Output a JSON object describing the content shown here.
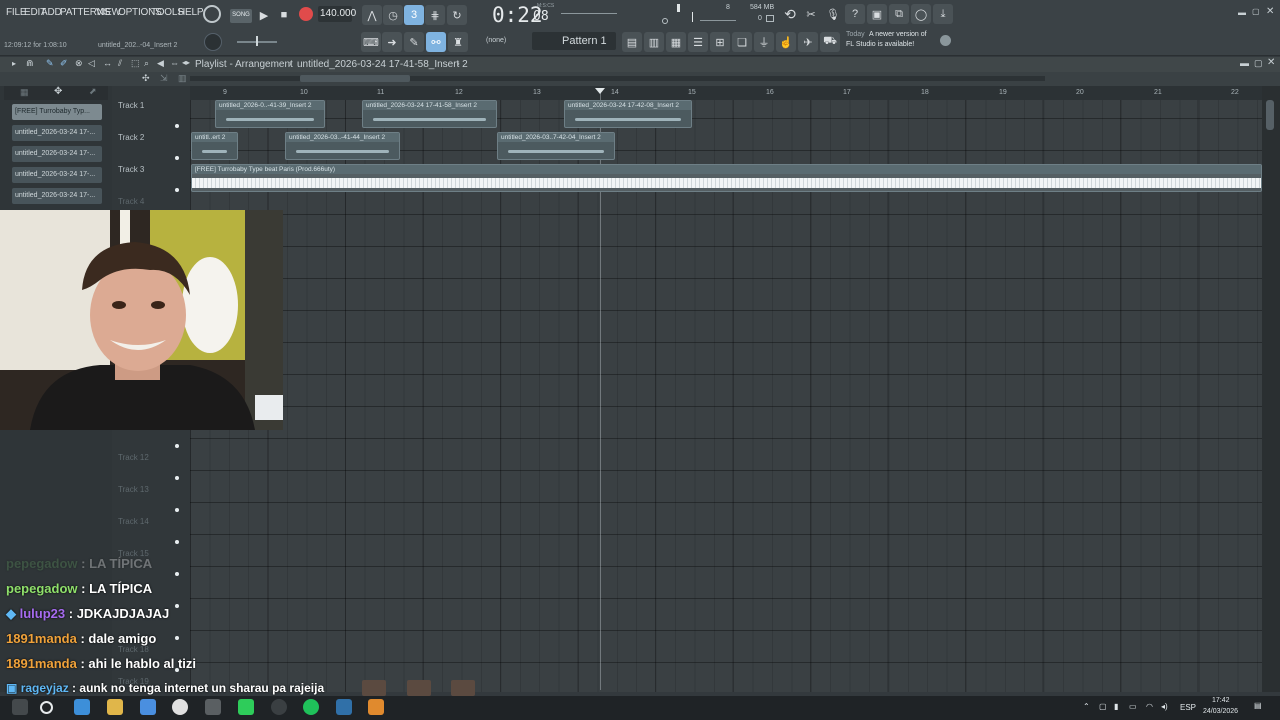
{
  "menu": [
    "FILE",
    "EDIT",
    "ADD",
    "PATTERNS",
    "VIEW",
    "OPTIONS",
    "TOOLS",
    "HELP"
  ],
  "toolbar": {
    "song_label": "SONG",
    "tempo": "140.000",
    "time": "0:22",
    "time_sub": "08",
    "time_unit": "M:S:CS",
    "memory": "584 MB",
    "cpu_top": "8",
    "cpu_bottom": "0",
    "snap": "(none)",
    "pattern": "Pattern 1",
    "news_date": "Today",
    "news_text_1": "A newer version of",
    "news_text_2": "FL Studio is available!",
    "hint_time": "12:09:12 for 1:08:10",
    "hint_file": "untitled_202..-04_Insert 2"
  },
  "playlist": {
    "title": "Playlist - Arrangement",
    "crumb": "untitled_2026-03-24 17-41-58_Insert 2",
    "ruler": [
      "9",
      "10",
      "11",
      "12",
      "13",
      "14",
      "15",
      "16",
      "17",
      "18",
      "19",
      "20",
      "21",
      "22"
    ],
    "tracks": [
      "Track 1",
      "Track 2",
      "Track 3",
      "Track 4",
      "Track 12",
      "Track 13",
      "Track 14",
      "Track 15",
      "Track 18",
      "Track 19"
    ],
    "clips_track1": [
      "untitled_2026-0..-41-39_Insert 2",
      "untitled_2026-03-24 17-41-58_Insert 2",
      "untitled_2026-03-24 17-42-08_Insert 2"
    ],
    "clips_track2": [
      "untitl..ert 2",
      "untitled_2026-03..-41-44_Insert 2",
      "untitled_2026-03..7-42-04_Insert 2"
    ],
    "clip_track3": "[FREE] Turrobaby Type beat Paris (Prod.666uty)"
  },
  "browser": [
    "[FREE] Turrobaby Typ...",
    "untitled_2026-03-24 17-...",
    "untitled_2026-03-24 17-...",
    "untitled_2026-03-24 17-...",
    "untitled_2026-03-24 17-..."
  ],
  "chat": [
    {
      "user": "pepegadow",
      "text": "LA TÍPICA",
      "color": "#5d9a5e",
      "faded": true
    },
    {
      "user": "pepegadow",
      "text": "LA TÍPICA",
      "color": "#8fe06b"
    },
    {
      "user": "lulup23",
      "text": "JDKAJDJAJAJ",
      "color": "#a66bf0"
    },
    {
      "user": "1891manda",
      "text": "dale amigo",
      "color": "#f0a23a"
    },
    {
      "user": "1891manda",
      "text": "ahi le hablo al tizi",
      "color": "#f0a23a"
    },
    {
      "user": "rageyjaz",
      "text": "aunk no tenga internet un sharau pa rajeija",
      "color": "#5fb8f5"
    }
  ],
  "taskbar": {
    "lang": "ESP",
    "clock": "17:42",
    "date": "24/03/2026"
  }
}
